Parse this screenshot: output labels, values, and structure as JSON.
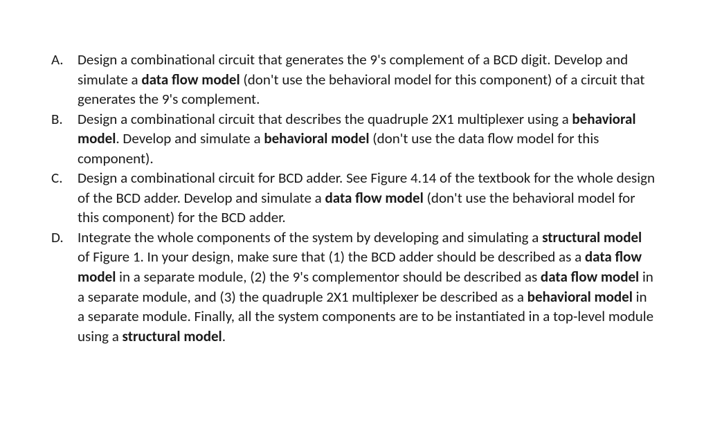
{
  "items": [
    {
      "marker": "A.",
      "segments": [
        {
          "t": "Design a combinational circuit that generates the 9's complement of a BCD digit. Develop and simulate a "
        },
        {
          "t": "data flow model",
          "b": true
        },
        {
          "t": " (don't use the behavioral model for this component) of a circuit that generates the 9's complement."
        }
      ]
    },
    {
      "marker": "B.",
      "segments": [
        {
          "t": "Design a combinational circuit that describes the quadruple 2X1 multiplexer using a "
        },
        {
          "t": "behavioral model",
          "b": true
        },
        {
          "t": ". Develop and simulate a "
        },
        {
          "t": "behavioral model",
          "b": true
        },
        {
          "t": " (don't use the data flow model for this component)."
        }
      ]
    },
    {
      "marker": "C.",
      "segments": [
        {
          "t": "Design a combinational circuit for BCD adder. See Figure 4.14 of the textbook for the whole design of the BCD adder. Develop and simulate a "
        },
        {
          "t": "data flow model",
          "b": true
        },
        {
          "t": " (don't use the behavioral model for this component) for the BCD adder."
        }
      ]
    },
    {
      "marker": "D.",
      "segments": [
        {
          "t": "Integrate the whole components of the system by developing and simulating a "
        },
        {
          "t": "structural model",
          "b": true
        },
        {
          "t": " of Figure 1. In your design, make sure that (1) the BCD adder should be described as a "
        },
        {
          "t": "data flow model",
          "b": true
        },
        {
          "t": " in a separate module, (2) the 9's complementor should be described as "
        },
        {
          "t": "data flow model",
          "b": true
        },
        {
          "t": " in a separate module, and (3) the quadruple 2X1 multiplexer be described as a "
        },
        {
          "t": "behavioral model",
          "b": true
        },
        {
          "t": " in a separate module.  Finally, all the system components are to be instantiated in a top-level module using a "
        },
        {
          "t": "structural model",
          "b": true
        },
        {
          "t": "."
        }
      ]
    }
  ]
}
